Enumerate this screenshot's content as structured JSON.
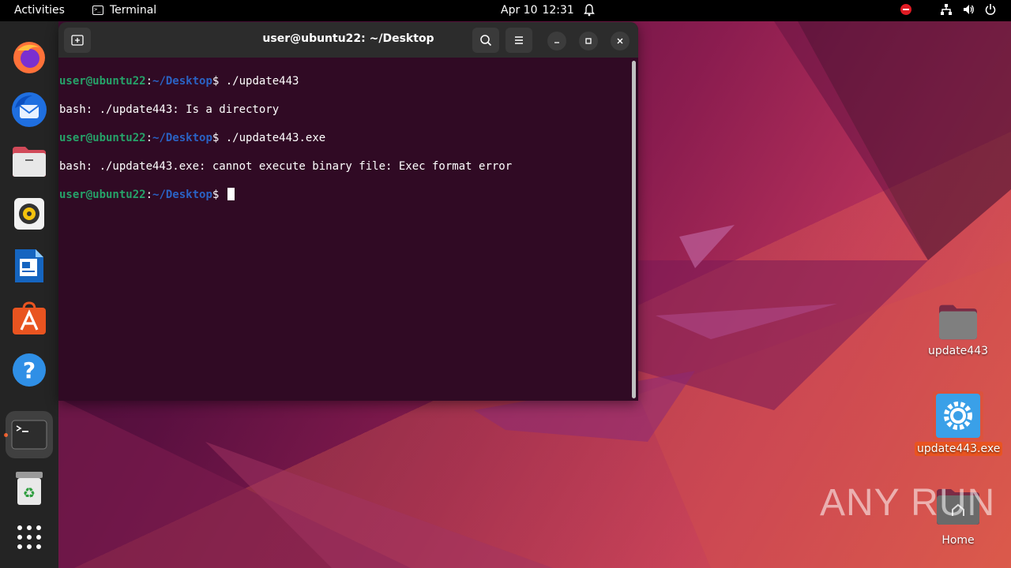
{
  "topbar": {
    "activities": "Activities",
    "app_name": "Terminal",
    "date": "Apr 10",
    "time": "12:31"
  },
  "dock": {
    "items": [
      "firefox",
      "thunderbird",
      "files",
      "rhythmbox",
      "libreoffice-writer",
      "app-center",
      "help",
      "terminal",
      "trash",
      "show-apps"
    ]
  },
  "terminal": {
    "title": "user@ubuntu22: ~/Desktop",
    "prompt_user": "user@ubuntu22",
    "prompt_sep": ":",
    "prompt_path": "~/Desktop",
    "prompt_end": "$",
    "lines": [
      {
        "type": "cmd",
        "text": " ./update443"
      },
      {
        "type": "out",
        "text": "bash: ./update443: Is a directory"
      },
      {
        "type": "cmd",
        "text": " ./update443.exe"
      },
      {
        "type": "out",
        "text": "bash: ./update443.exe: cannot execute binary file: Exec format error"
      },
      {
        "type": "cmd",
        "text": " "
      }
    ]
  },
  "desktop": {
    "icons": [
      {
        "label": "update443",
        "kind": "folder"
      },
      {
        "label": "update443.exe",
        "kind": "executable"
      },
      {
        "label": "Home",
        "kind": "home"
      }
    ]
  },
  "watermark": "ANY RUN",
  "colors": {
    "accent": "#e95420",
    "terminal_bg": "#300a24",
    "prompt_user": "#26a269",
    "prompt_path": "#2a62c4"
  }
}
